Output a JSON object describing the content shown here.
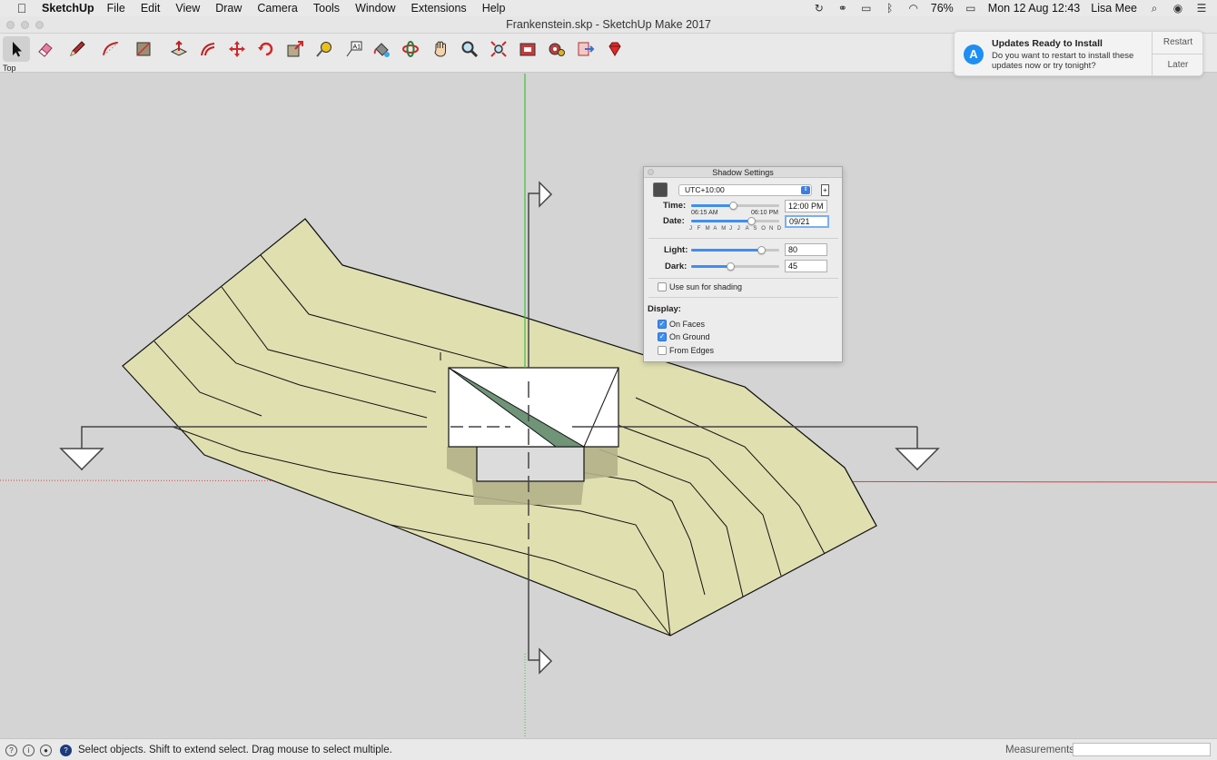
{
  "menubar": {
    "app_name": "SketchUp",
    "menus": [
      "File",
      "Edit",
      "View",
      "Draw",
      "Camera",
      "Tools",
      "Window",
      "Extensions",
      "Help"
    ],
    "battery": "76%",
    "clock": "Mon 12 Aug  12:43",
    "user": "Lisa Mee"
  },
  "window": {
    "title": "Frankenstein.skp - SketchUp Make 2017"
  },
  "toolbar": {
    "tools": [
      "select-tool",
      "eraser-tool",
      "pencil-tool",
      "arc-tool",
      "shape-tool",
      "push-pull-tool",
      "offset-tool",
      "move-tool",
      "rotate-tool",
      "scale-tool",
      "tape-measure-tool",
      "text-tool",
      "paint-bucket-tool",
      "orbit-tool",
      "pan-tool",
      "zoom-tool",
      "zoom-extents-tool",
      "warehouse-tool",
      "extension-warehouse-tool",
      "send-to-layout-tool",
      "ruby-tool"
    ]
  },
  "scene": {
    "view_label": "Top"
  },
  "notification": {
    "title": "Updates Ready to Install",
    "body": "Do you want to restart to install these updates now or try tonight?",
    "primary_button": "Restart",
    "secondary_button": "Later"
  },
  "shadow_settings": {
    "title": "Shadow Settings",
    "timezone": "UTC+10:00",
    "time_label": "Time:",
    "time_value": "12:00 PM",
    "time_fraction": 0.48,
    "sunrise": "06:15 AM",
    "sunset": "06:10 PM",
    "date_label": "Date:",
    "date_value": "09/21",
    "date_fraction": 0.69,
    "months": [
      "J",
      "F",
      "M",
      "A",
      "M",
      "J",
      "J",
      "A",
      "S",
      "O",
      "N",
      "D"
    ],
    "light_label": "Light:",
    "light_value": "80",
    "light_fraction": 0.8,
    "dark_label": "Dark:",
    "dark_value": "45",
    "dark_fraction": 0.45,
    "use_sun_label": "Use sun for shading",
    "use_sun_checked": false,
    "display_label": "Display:",
    "on_faces_label": "On Faces",
    "on_faces_checked": true,
    "on_ground_label": "On Ground",
    "on_ground_checked": true,
    "from_edges_label": "From Edges",
    "from_edges_checked": false
  },
  "statusbar": {
    "hint": "Select objects. Shift to extend select. Drag mouse to select multiple.",
    "measurements_label": "Measurements",
    "measurements_value": ""
  },
  "colors": {
    "terrain_fill": "#e0dfb0",
    "terrain_shadow": "#b3b18a",
    "roof_shade": "#6f9478",
    "green_axis": "#3fbf3f",
    "red_axis": "#d84040",
    "accent_blue": "#3e8ef0"
  }
}
